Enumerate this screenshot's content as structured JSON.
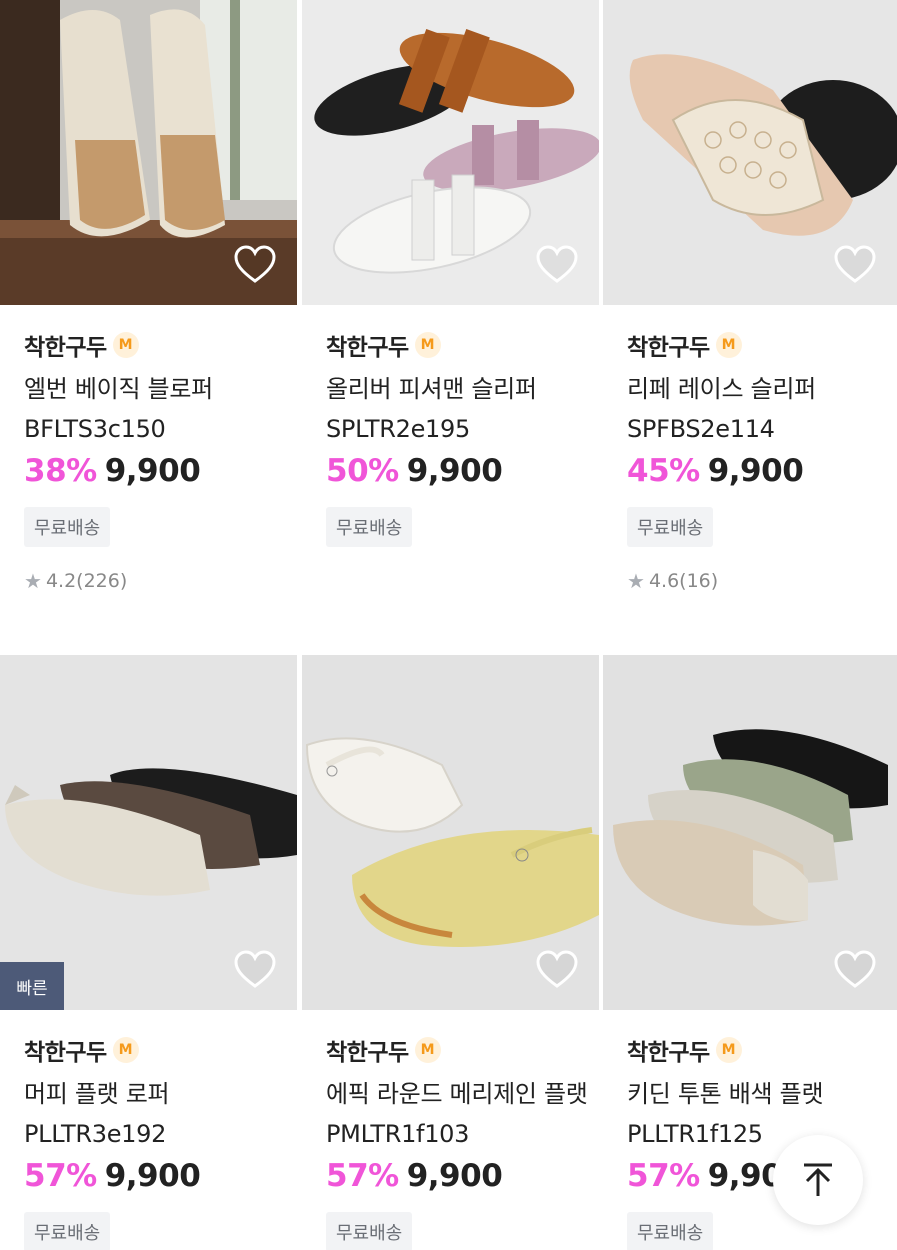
{
  "products": [
    {
      "brand": "착한구두",
      "badge": "M",
      "name": "엘번 베이직 블로퍼 BFLTS3c150",
      "discount": "38%",
      "price": "9,900",
      "shipping": "무료배송",
      "rating": "4.2",
      "reviews": "(226)"
    },
    {
      "brand": "착한구두",
      "badge": "M",
      "name": "올리버 피셔맨 슬리퍼 SPLTR2e195",
      "discount": "50%",
      "price": "9,900",
      "shipping": "무료배송"
    },
    {
      "brand": "착한구두",
      "badge": "M",
      "name": "리페 레이스 슬리퍼 SPFBS2e114",
      "discount": "45%",
      "price": "9,900",
      "shipping": "무료배송",
      "rating": "4.6",
      "reviews": "(16)"
    },
    {
      "brand": "착한구두",
      "badge": "M",
      "name": "머피 플랫 로퍼 PLLTR3e192",
      "discount": "57%",
      "price": "9,900",
      "shipping": "무료배송",
      "tag": "빠른"
    },
    {
      "brand": "착한구두",
      "badge": "M",
      "name": "에픽 라운드 메리제인 플랫 PMLTR1f103",
      "discount": "57%",
      "price": "9,900",
      "shipping": "무료배송"
    },
    {
      "brand": "착한구두",
      "badge": "M",
      "name": "키딘 투톤 배색 플랫 PLLTR1f125",
      "discount": "57%",
      "price": "9,90",
      "shipping": "무료배송"
    }
  ],
  "colors": {
    "discount": "#f055d8",
    "badge_bg": "#fff1da",
    "badge_text": "#f59a1b",
    "fast_tag": "#4d5a78"
  },
  "icons": {
    "wishlist": "heart-outline-icon",
    "scroll_top": "arrow-up-icon",
    "rating": "star-icon"
  }
}
